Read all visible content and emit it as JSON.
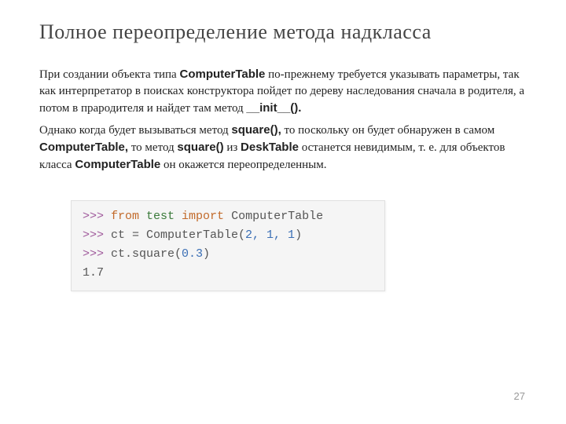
{
  "title": "Полное переопределение метода надкласса",
  "para1": {
    "t1": "При создании объекта типа ",
    "b1": "ComputerTable",
    "t2": " по-прежнему требуется указывать параметры, так как интерпретатор в поисках конструктора пойдет по дереву наследования сначала в родителя, а потом в прародителя и найдет там метод ",
    "b2": "__init__().",
    "t3": ""
  },
  "para2": {
    "t1": "Однако когда будет вызываться метод ",
    "b1": "square(),",
    "t2": " то поскольку он будет обнаружен в самом ",
    "b2": "ComputerTable,",
    "t3": " то метод ",
    "b3": "square()",
    "t4": " из ",
    "b4": "DeskTable",
    "t5": " останется невидимым, т. е. для объектов класса ",
    "b5": "ComputerTable",
    "t6": " он окажется переопределенным."
  },
  "code": {
    "l1": {
      "prompt": ">>> ",
      "kw1": "from",
      "mod": " test ",
      "kw2": "import",
      "name": " ComputerTable"
    },
    "l2": {
      "prompt": ">>> ",
      "text": "ct = ComputerTable(",
      "args": "2, 1, 1",
      "close": ")"
    },
    "l3": {
      "prompt": ">>> ",
      "text": "ct.square(",
      "args": "0.3",
      "close": ")"
    },
    "l4": {
      "out": "1.7"
    }
  },
  "pageNumber": "27"
}
